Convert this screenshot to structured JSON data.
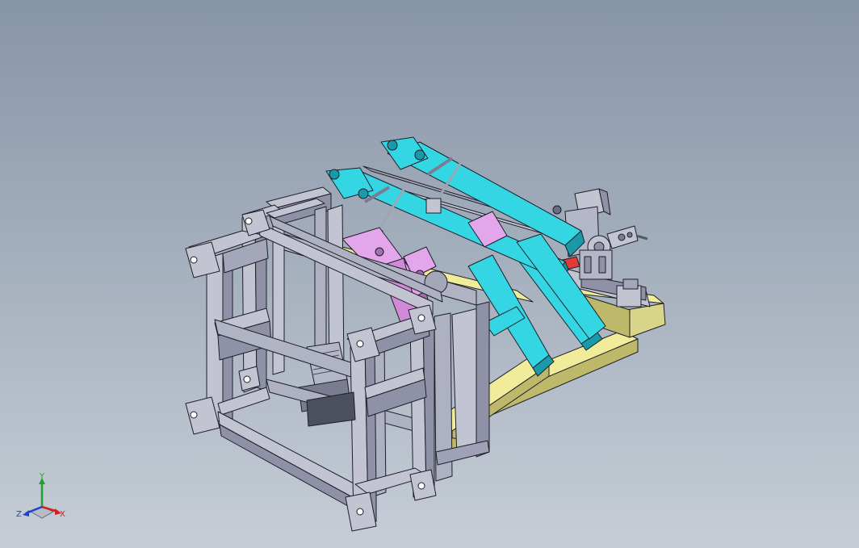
{
  "viewport": {
    "background_top": "#8795a8",
    "background_bottom": "#c6cdd6"
  },
  "model": {
    "name": "",
    "part_colors": {
      "frame_steel": "#c2c4d2",
      "frame_steel_shade": "#8f92a6",
      "base_beam": "#f0ec9a",
      "base_beam_shade": "#bdb86a",
      "clamp_arm_cyan": "#35d6e4",
      "clamp_arm_cyan_shade": "#1a9aa8",
      "clamp_arm_pink": "#e4a6ea",
      "clamp_arm_pink_shade": "#a56eb0",
      "fastener_red": "#e03a3a",
      "edge_line": "#1e1e28"
    }
  },
  "axis_triad": {
    "x_label": "X",
    "y_label": "Y",
    "z_label": "Z",
    "x_color": "#d02020",
    "y_color": "#20a030",
    "z_color": "#2040d0"
  }
}
